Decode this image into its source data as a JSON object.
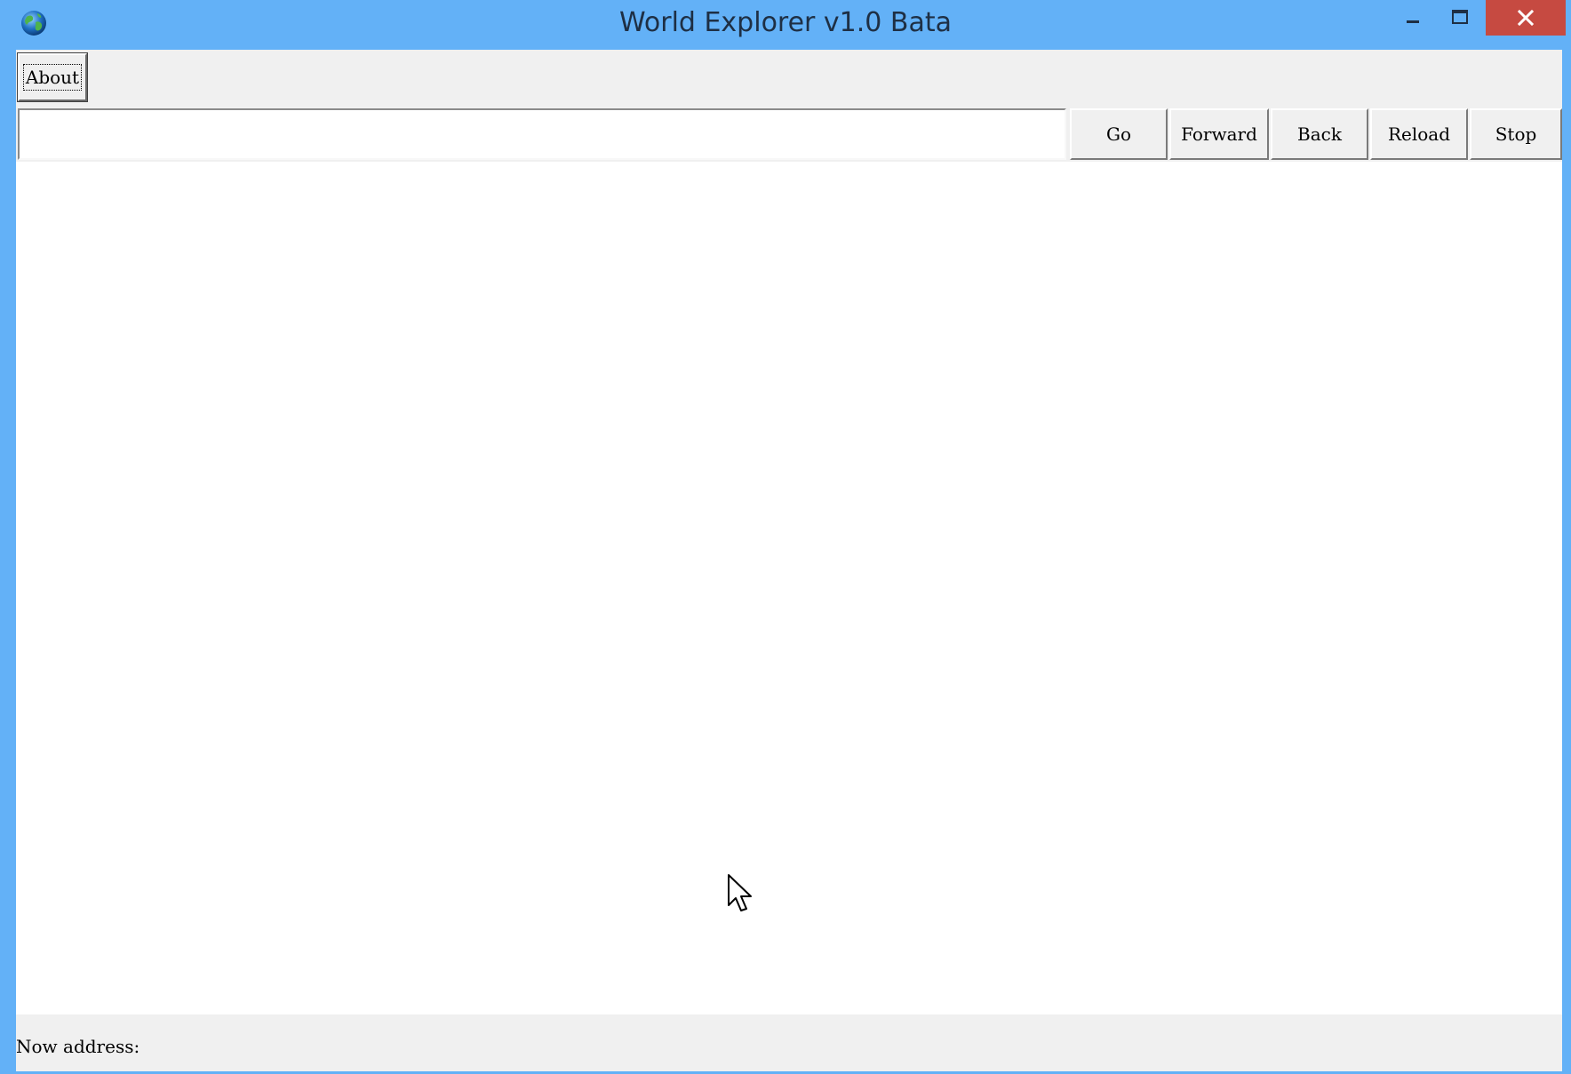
{
  "window": {
    "title": "World Explorer v1.0 Bata",
    "app_icon": "globe-icon",
    "controls": {
      "minimize_icon": "minimize-icon",
      "maximize_icon": "maximize-icon",
      "close_icon": "close-icon",
      "close_color": "#c64a41"
    },
    "titlebar_color": "#63b1f7"
  },
  "toolbar": {
    "about_label": "About"
  },
  "address_bar": {
    "value": "",
    "placeholder": ""
  },
  "nav_buttons": {
    "go": "Go",
    "forward": "Forward",
    "back": "Back",
    "reload": "Reload",
    "stop": "Stop"
  },
  "status": {
    "label": "Now address:"
  }
}
